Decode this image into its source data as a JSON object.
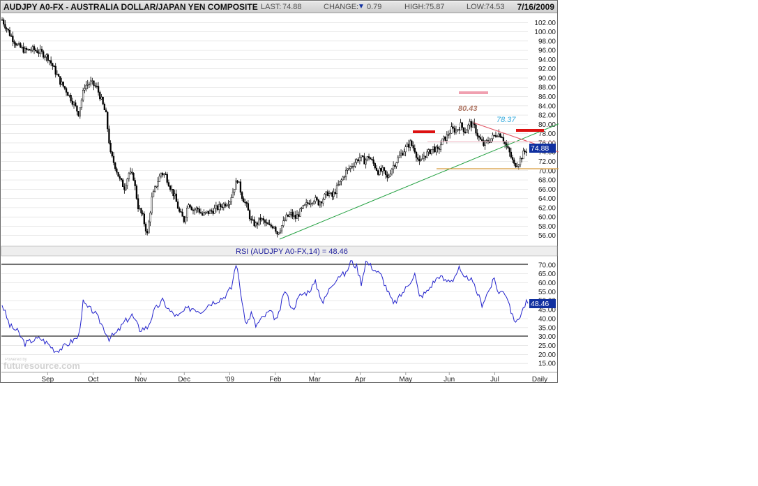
{
  "header": {
    "title": "AUDJPY A0-FX - AUSTRALIA DOLLAR/JAPAN YEN COMPOSITE",
    "last_label": "LAST:",
    "last_value": "74.88",
    "change_label": "CHANGE:",
    "change_value": "0.79",
    "high_label": "HIGH:",
    "high_value": "75.87",
    "low_label": "LOW:",
    "low_value": "74.53",
    "date": "7/16/2009"
  },
  "chart_data": [
    {
      "type": "candlestick",
      "title": "AUDJPY A0-FX - AUSTRALIA DOLLAR/JAPAN YEN COMPOSITE",
      "period": "Daily",
      "x_range": [
        "2008-08-01",
        "2009-07-16"
      ],
      "ylim": [
        54,
        104
      ],
      "y_ticks": [
        "56.00",
        "58.00",
        "60.00",
        "62.00",
        "64.00",
        "66.00",
        "68.00",
        "70.00",
        "72.00",
        "74.00",
        "76.00",
        "78.00",
        "80.00",
        "82.00",
        "84.00",
        "86.00",
        "88.00",
        "90.00",
        "92.00",
        "94.00",
        "96.00",
        "98.00",
        "100.00",
        "102.00"
      ],
      "last_price_label": "74.88",
      "x_month_labels": [
        "Sep",
        "Oct",
        "Nov",
        "Dec",
        "'09",
        "Feb",
        "Mar",
        "Apr",
        "May",
        "Jun",
        "Jul"
      ],
      "x_period_label": "Daily",
      "grid": true,
      "annotations": [
        "80.43",
        "78.37"
      ],
      "series": [
        {
          "values": [
            [
              0,
              102.6
            ],
            [
              5,
              99.5
            ],
            [
              10,
              97.0
            ],
            [
              15,
              95.9
            ],
            [
              20,
              96.2
            ],
            [
              25,
              95.6
            ],
            [
              30,
              94.5
            ],
            [
              34,
              92.0
            ],
            [
              38,
              89.2
            ],
            [
              42,
              87.3
            ],
            [
              46,
              85.0
            ],
            [
              50,
              82.4
            ],
            [
              54,
              88.3
            ],
            [
              58,
              89.0
            ],
            [
              62,
              87.9
            ],
            [
              65,
              85.2
            ],
            [
              68,
              82.0
            ],
            [
              71,
              73.5
            ],
            [
              74,
              71.0
            ],
            [
              77,
              68.0
            ],
            [
              80,
              66.4
            ],
            [
              83,
              69.5
            ],
            [
              86,
              68.5
            ],
            [
              89,
              62.2
            ],
            [
              92,
              60.0
            ],
            [
              95,
              56.2
            ],
            [
              98,
              64.0
            ],
            [
              101,
              67.0
            ],
            [
              104,
              69.5
            ],
            [
              107,
              69.0
            ],
            [
              110,
              66.5
            ],
            [
              113,
              64.3
            ],
            [
              116,
              61.0
            ],
            [
              119,
              59.3
            ],
            [
              122,
              63.2
            ],
            [
              125,
              61.5
            ],
            [
              128,
              61.8
            ],
            [
              131,
              60.4
            ],
            [
              134,
              60.9
            ],
            [
              137,
              61.2
            ],
            [
              140,
              61.8
            ],
            [
              143,
              62.3
            ],
            [
              146,
              62.9
            ],
            [
              149,
              63.6
            ],
            [
              152,
              66.5
            ],
            [
              154,
              68.1
            ],
            [
              157,
              64.5
            ],
            [
              160,
              62.3
            ],
            [
              163,
              59.0
            ],
            [
              166,
              58.3
            ],
            [
              169,
              59.6
            ],
            [
              172,
              58.7
            ],
            [
              175,
              57.9
            ],
            [
              178,
              58.2
            ],
            [
              180,
              56.5
            ],
            [
              183,
              58.1
            ],
            [
              186,
              59.9
            ],
            [
              189,
              60.6
            ],
            [
              192,
              59.8
            ],
            [
              195,
              61.1
            ],
            [
              198,
              62.3
            ],
            [
              201,
              63.3
            ],
            [
              204,
              63.9
            ],
            [
              207,
              63.1
            ],
            [
              210,
              64.0
            ],
            [
              213,
              65.2
            ],
            [
              216,
              64.4
            ],
            [
              219,
              66.2
            ],
            [
              222,
              67.9
            ],
            [
              225,
              69.8
            ],
            [
              228,
              70.8
            ],
            [
              231,
              71.9
            ],
            [
              234,
              72.9
            ],
            [
              237,
              72.1
            ],
            [
              240,
              73.0
            ],
            [
              243,
              71.5
            ],
            [
              246,
              69.8
            ],
            [
              249,
              70.0
            ],
            [
              252,
              68.3
            ],
            [
              255,
              70.6
            ],
            [
              258,
              72.1
            ],
            [
              261,
              73.6
            ],
            [
              264,
              74.8
            ],
            [
              267,
              76.0
            ],
            [
              270,
              74.5
            ],
            [
              273,
              71.5
            ],
            [
              276,
              73.2
            ],
            [
              279,
              73.9
            ],
            [
              282,
              74.9
            ],
            [
              285,
              74.2
            ],
            [
              288,
              76.4
            ],
            [
              291,
              77.4
            ],
            [
              294,
              78.9
            ],
            [
              297,
              78.7
            ],
            [
              300,
              79.8
            ],
            [
              303,
              78.5
            ],
            [
              306,
              80.2
            ],
            [
              309,
              79.4
            ],
            [
              312,
              77.0
            ],
            [
              315,
              75.6
            ],
            [
              318,
              76.4
            ],
            [
              321,
              77.2
            ],
            [
              324,
              78.1
            ],
            [
              327,
              77.6
            ],
            [
              329,
              75.8
            ],
            [
              332,
              73.8
            ],
            [
              335,
              71.2
            ],
            [
              338,
              71.8
            ],
            [
              341,
              73.7
            ],
            [
              344,
              74.9
            ]
          ]
        }
      ]
    },
    {
      "type": "line",
      "title": "RSI (AUDJPY A0-FX,14) = 48.46",
      "ylim": [
        10,
        75
      ],
      "y_ticks": [
        "15.00",
        "20.00",
        "25.00",
        "30.00",
        "35.00",
        "40.00",
        "45.00",
        "50.00",
        "55.00",
        "60.00",
        "65.00",
        "70.00"
      ],
      "reference_levels": [
        70,
        30
      ],
      "last_value_label": "48.46",
      "series": [
        {
          "values": [
            [
              0,
              48
            ],
            [
              5,
              36
            ],
            [
              10,
              33
            ],
            [
              15,
              26
            ],
            [
              20,
              28
            ],
            [
              25,
              29
            ],
            [
              30,
              26
            ],
            [
              35,
              22
            ],
            [
              40,
              24
            ],
            [
              45,
              27
            ],
            [
              50,
              30
            ],
            [
              53,
              49
            ],
            [
              56,
              46
            ],
            [
              60,
              44
            ],
            [
              65,
              37
            ],
            [
              70,
              29
            ],
            [
              75,
              32
            ],
            [
              80,
              38
            ],
            [
              85,
              42
            ],
            [
              90,
              34
            ],
            [
              95,
              35
            ],
            [
              100,
              45
            ],
            [
              105,
              50
            ],
            [
              110,
              44
            ],
            [
              115,
              41
            ],
            [
              120,
              45
            ],
            [
              125,
              46
            ],
            [
              130,
              44
            ],
            [
              135,
              48
            ],
            [
              140,
              50
            ],
            [
              145,
              52
            ],
            [
              150,
              57
            ],
            [
              153,
              71
            ],
            [
              155,
              62
            ],
            [
              158,
              43
            ],
            [
              160,
              37
            ],
            [
              163,
              43
            ],
            [
              166,
              36
            ],
            [
              170,
              40
            ],
            [
              175,
              44
            ],
            [
              180,
              39
            ],
            [
              185,
              56
            ],
            [
              190,
              45
            ],
            [
              195,
              53
            ],
            [
              200,
              55
            ],
            [
              205,
              60
            ],
            [
              210,
              49
            ],
            [
              215,
              58
            ],
            [
              220,
              64
            ],
            [
              225,
              65
            ],
            [
              228,
              72
            ],
            [
              232,
              69
            ],
            [
              235,
              60
            ],
            [
              238,
              72
            ],
            [
              243,
              68
            ],
            [
              248,
              64
            ],
            [
              253,
              54
            ],
            [
              256,
              48
            ],
            [
              260,
              52
            ],
            [
              265,
              58
            ],
            [
              270,
              65
            ],
            [
              273,
              52
            ],
            [
              278,
              55
            ],
            [
              282,
              60
            ],
            [
              286,
              64
            ],
            [
              290,
              61
            ],
            [
              295,
              62
            ],
            [
              299,
              68
            ],
            [
              302,
              62
            ],
            [
              306,
              63
            ],
            [
              310,
              56
            ],
            [
              314,
              48
            ],
            [
              318,
              55
            ],
            [
              322,
              62
            ],
            [
              325,
              54
            ],
            [
              328,
              56
            ],
            [
              331,
              51
            ],
            [
              334,
              41
            ],
            [
              337,
              38
            ],
            [
              340,
              44
            ],
            [
              343,
              49
            ],
            [
              344,
              48.46
            ]
          ]
        }
      ]
    }
  ],
  "colors": {
    "uptrend_line": "#22a040",
    "downtrend_line": "#e05060",
    "support_line": "#d89a3a",
    "resistance_marks": "#dd1111",
    "target_mark": "#f0a0b0",
    "label_80": "#b07a68",
    "label_78": "#33aadd",
    "rsi_line": "#2222cc",
    "last_price_bg": "#1030a0"
  },
  "watermark": {
    "small": "Powered by",
    "text": "futuresource.com"
  }
}
